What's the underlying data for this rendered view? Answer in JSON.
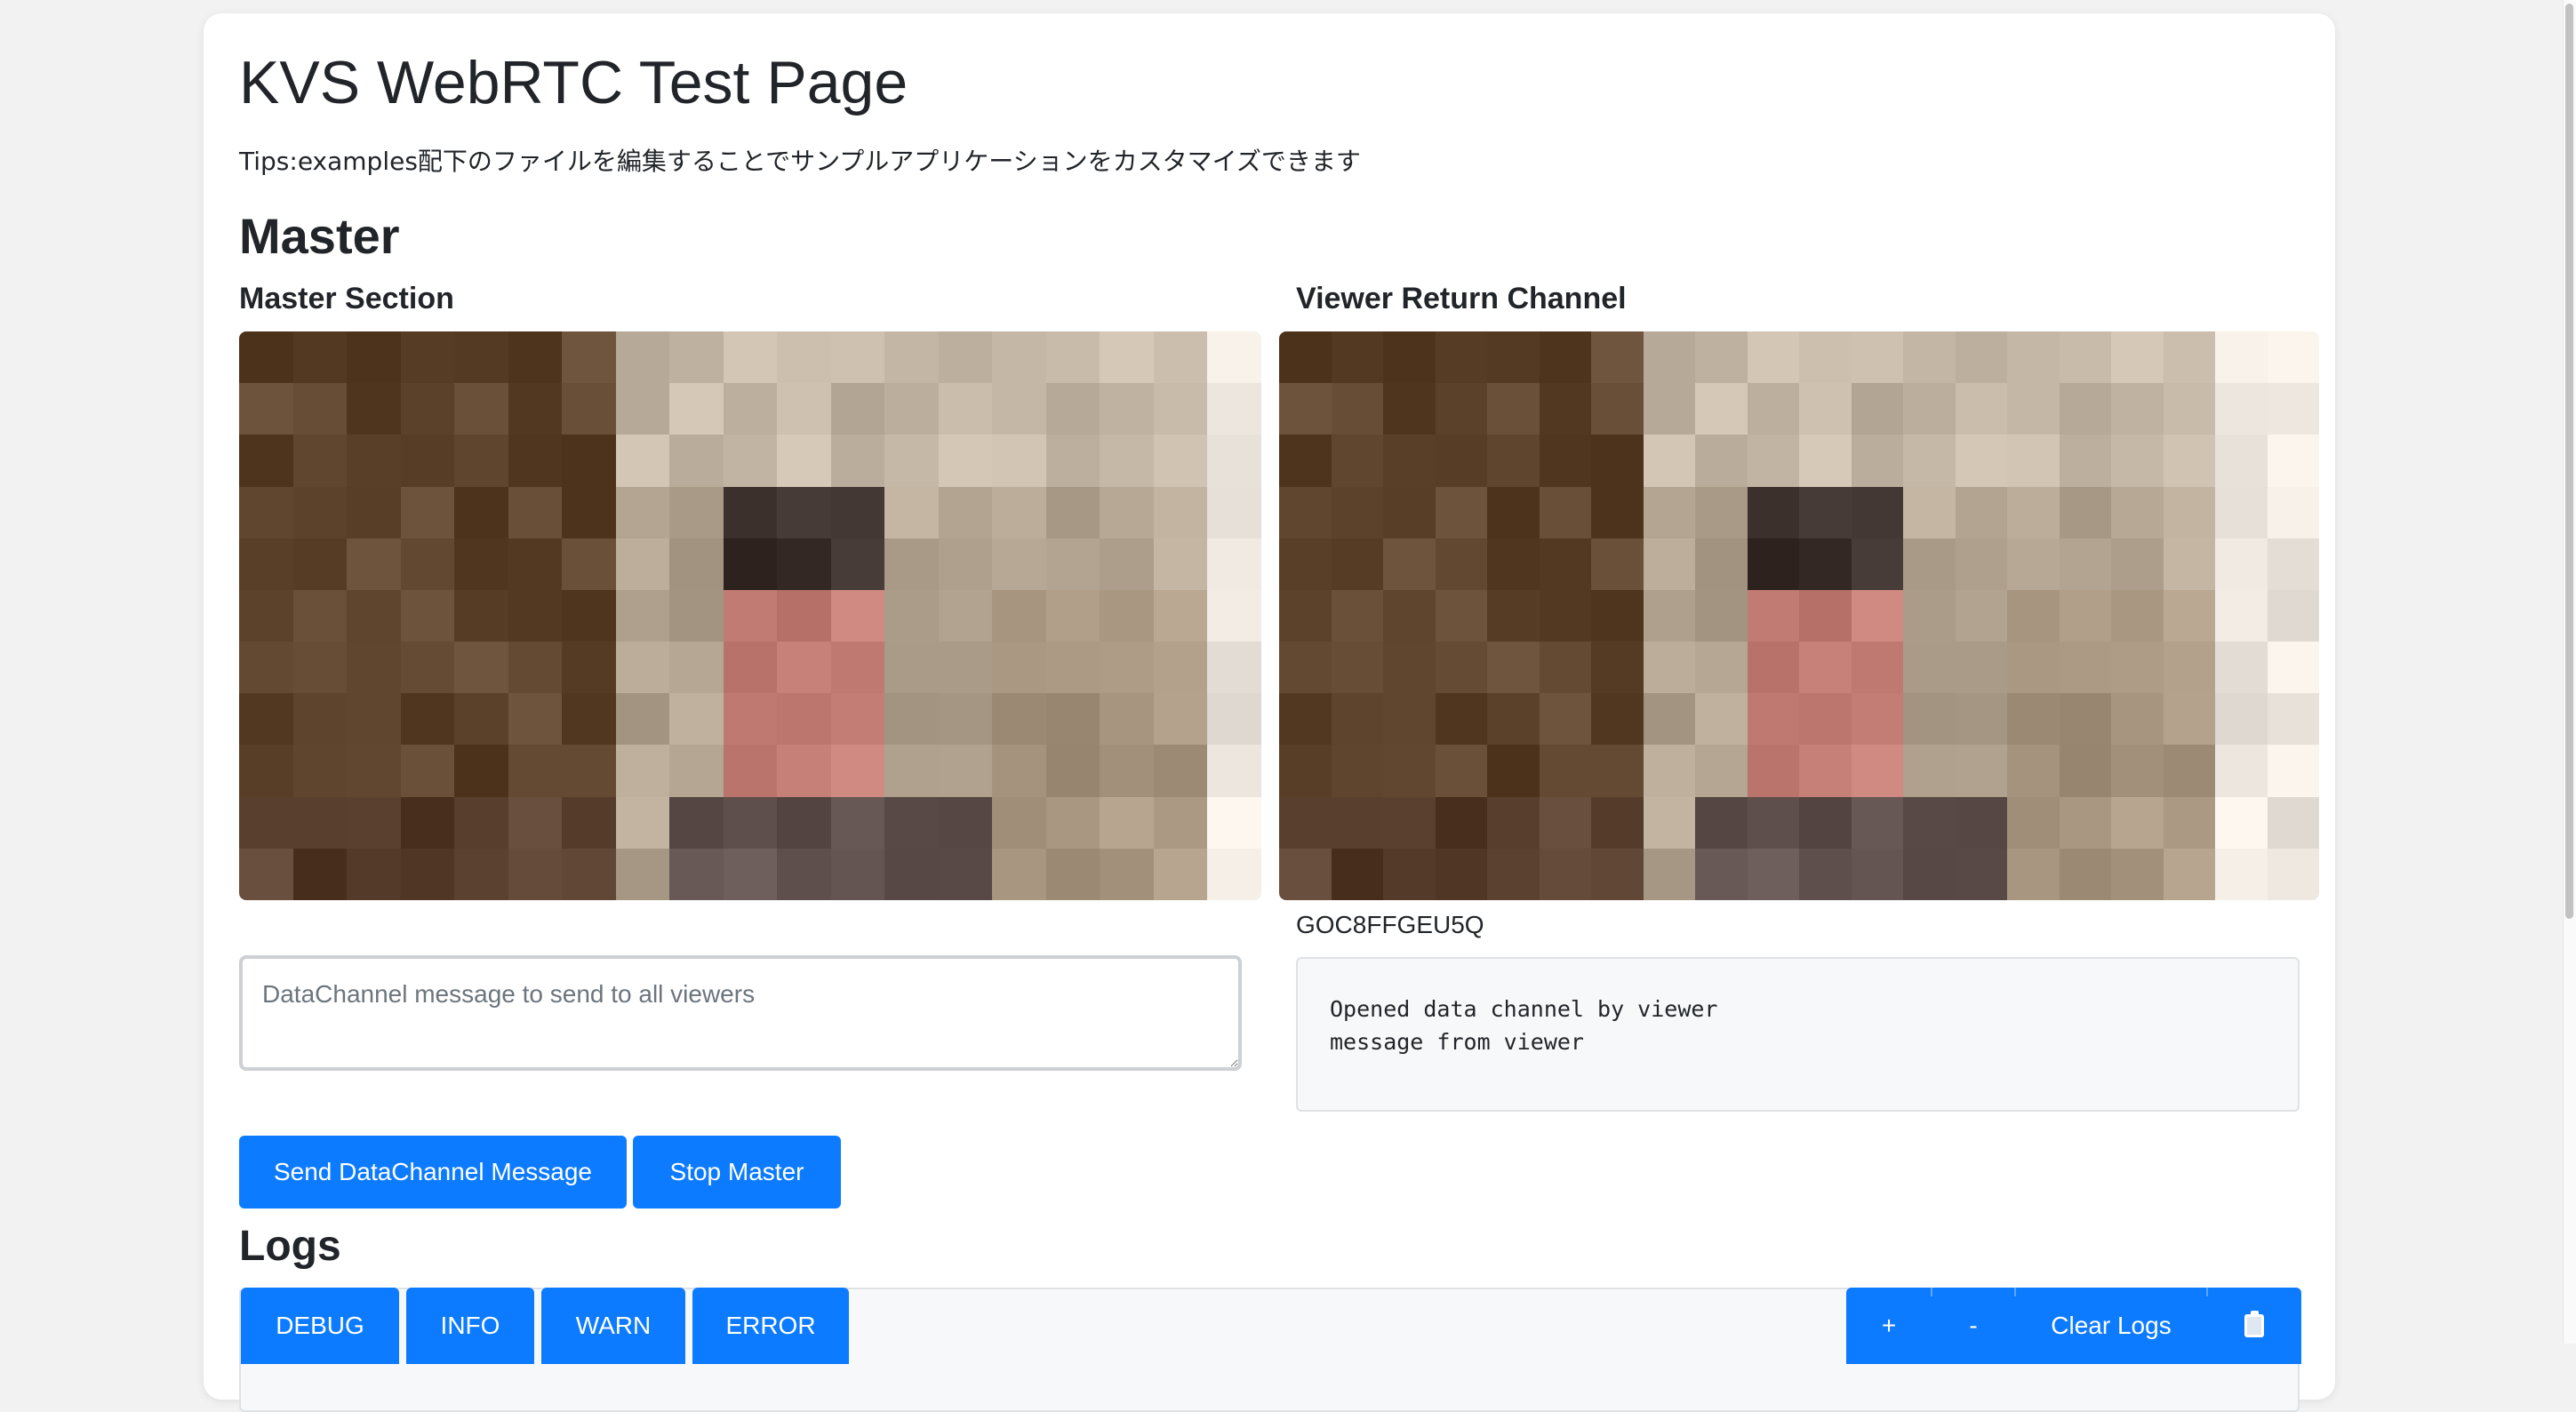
{
  "page": {
    "title": "KVS WebRTC Test Page",
    "tips": "Tips:examples配下のファイルを編集することでサンプルアプリケーションをカスタマイズできます"
  },
  "master": {
    "heading": "Master",
    "local_section_title": "Master Section",
    "remote_section_title": "Viewer Return Channel",
    "remote_client_id": "GOC8FFGEU5Q",
    "dc_input_placeholder": "DataChannel message to send to all viewers",
    "dc_input_value": "",
    "dc_received_text": "Opened data channel by viewer\nmessage from viewer",
    "send_button_label": "Send DataChannel Message",
    "stop_button_label": "Stop Master"
  },
  "logs": {
    "heading": "Logs",
    "levels": [
      "DEBUG",
      "INFO",
      "WARN",
      "ERROR"
    ],
    "increase_label": "+",
    "decrease_label": "-",
    "clear_label": "Clear Logs",
    "copy_icon": "clipboard-icon"
  },
  "colors": {
    "accent": "#0d7bff",
    "card_bg": "#ffffff",
    "page_bg": "#f2f2f2"
  }
}
